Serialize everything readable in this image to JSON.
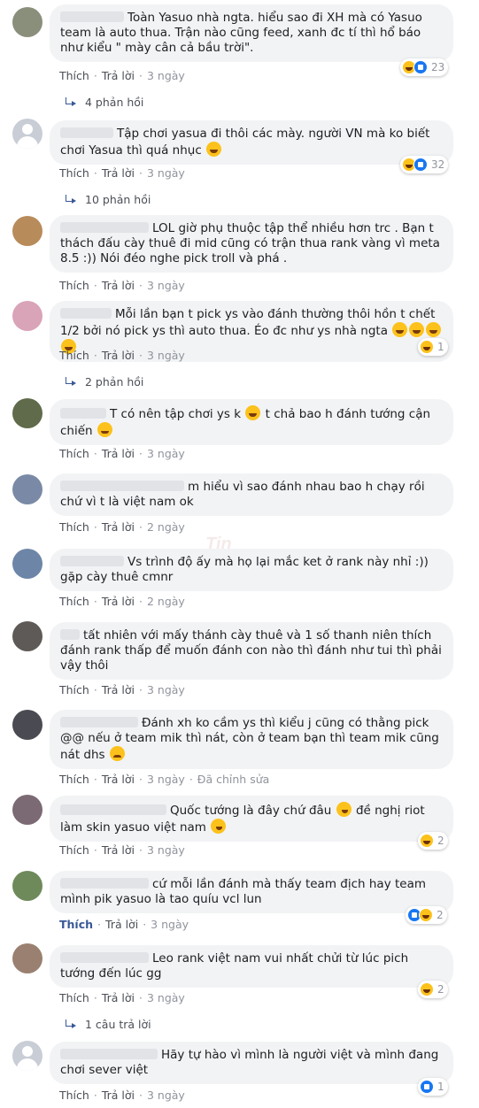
{
  "actions": {
    "like": "Thích",
    "reply": "Trả lời",
    "edited": "Đã chỉnh sửa"
  },
  "comments": [
    {
      "avatar_color": "#8a8f7c",
      "text": "Toàn Yasuo nhà ngta.  hiểu sao đi XH mà có Yasuo team là auto thua. Trận nào cũng feed, xanh đc tí thì hổ báo như kiểu \" mày cân cả bầu trời\".",
      "time": "3 ngày",
      "reactions": "23",
      "replies": "4 phản hồi"
    },
    {
      "avatar_color": "",
      "text": "Tập chơi yasua đi thôi các mày. người VN mà ko biết chơi Yasua thì quá nhục",
      "time": "3 ngày",
      "reactions": "32",
      "replies": "10 phản hồi"
    },
    {
      "avatar_color": "#b88b5a",
      "text": "LOL giờ phụ thuộc tập thể nhiều hơn trc . Bạn t thách đấu cày thuê đi mid cũng có trận thua rank vàng vì meta 8.5 :)) Nói đéo nghe pick troll và phá .",
      "time": "3 ngày"
    },
    {
      "avatar_color": "#d9a3b8",
      "text": "Mỗi lần bạn t pick ys vào đánh thường thôi hồn t chết 1/2 bởi nó pick ys thì auto thua. Éo đc như ys nhà ngta",
      "time": "3 ngày",
      "reactions": "1",
      "replies": "2 phản hồi"
    },
    {
      "avatar_color": "#5f6b4a",
      "text_a": "T có nên tập chơi ys k",
      "text_b": "t chả bao h đánh tướng cận chiến",
      "time": "3 ngày"
    },
    {
      "avatar_color": "#7a8aa6",
      "text": "m hiểu vì sao đánh nhau  bao h chạy rồi chứ vì t là việt nam ok",
      "time": "2 ngày"
    },
    {
      "avatar_color": "#6d86a8",
      "text": "Vs trình độ ấy mà họ lại mắc ket ở rank này nhỉ :)) gặp cày thuê cmnr",
      "time": "2 ngày"
    },
    {
      "avatar_color": "#5e5a57",
      "text": "tất nhiên với mấy thánh cày thuê và 1 số thanh niên thích đánh rank thấp để muốn đánh con nào thì đánh như tui thì phải vậy thôi",
      "time": "3 ngày"
    },
    {
      "avatar_color": "#4a4a52",
      "text": "Đánh xh ko cầm ys thì kiểu j cũng có thằng pick @@ nếu ở team mik thì nát, còn ở team bạn thì team mik cũng nát dhs",
      "time": "3 ngày"
    },
    {
      "avatar_color": "#7b6a73",
      "text_a": "Quốc tướng là đây chứ đâu",
      "text_b": "đề nghị riot làm skin yasuo việt nam",
      "time": "3 ngày",
      "reactions": "2"
    },
    {
      "avatar_color": "#6e8a5a",
      "text": "cứ mỗi lần đánh mà thấy team địch hay team mình pik yasuo là tao quíu vcl lun",
      "time": "3 ngày",
      "reactions": "2"
    },
    {
      "avatar_color": "#9a8070",
      "text": "Leo rank việt nam vui nhất chửi từ lúc pich tướng đến lúc gg",
      "time": "3 ngày",
      "reactions": "2",
      "replies": "1 câu trả lời"
    },
    {
      "avatar_color": "",
      "text": "Hãy tự hào vì mình là người việt và mình đang chơi sever việt",
      "time": "3 ngày",
      "reactions": "1"
    }
  ]
}
